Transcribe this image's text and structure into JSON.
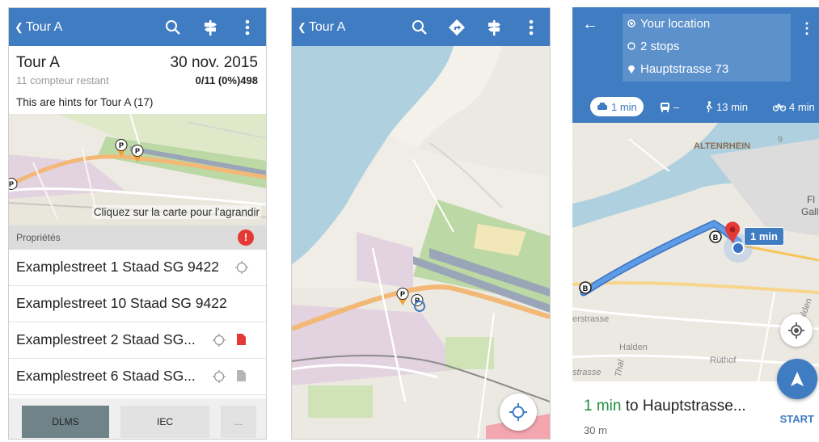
{
  "screen_a": {
    "appbar": {
      "back_label": "Tour A"
    },
    "tour": {
      "title": "Tour A",
      "date": "30 nov. 2015",
      "remaining": "11 compteur restant",
      "progress": "0/11 (0%)498",
      "hints": "This are hints for Tour A (17)"
    },
    "map_hint": "Cliquez sur la carte pour l'agrandir",
    "properties_label": "Propriétés",
    "properties_badge": "!",
    "addresses": [
      {
        "text": "Examplestreet 1 Staad SG 9422"
      },
      {
        "text": "Examplestreet 10 Staad SG 9422"
      },
      {
        "text": "Examplestreet 2 Staad SG..."
      },
      {
        "text": "Examplestreet 6 Staad SG..."
      }
    ],
    "buttons": {
      "dlms": "DLMS",
      "iec": "IEC",
      "more": "..."
    }
  },
  "screen_b": {
    "appbar": {
      "back_label": "Tour A"
    }
  },
  "screen_c": {
    "route": {
      "origin": "Your location",
      "stops": "2 stops",
      "destination": "Hauptstrasse 73"
    },
    "modes": {
      "car": "1 min",
      "transit": "–",
      "walk": "13 min",
      "bike": "4 min"
    },
    "map_labels": {
      "town": "ALTENRHEIN",
      "road_number": "9",
      "place_right": "Fl",
      "place_right_2": "Gall",
      "street_left": "erstrasse",
      "area_1": "Halden",
      "area_2": "Rüthof",
      "area_3": "Halden",
      "street_bottom": "strasse",
      "street_bottom_2": "Thal"
    },
    "callout": "1 min",
    "summary": {
      "duration": "1 min",
      "rest": " to Hauptstrasse...",
      "distance": "30 m"
    },
    "start_label": "START"
  },
  "colors": {
    "accent": "#3f7cc2",
    "route": "#4a8fd9",
    "pin": "#e53935"
  }
}
